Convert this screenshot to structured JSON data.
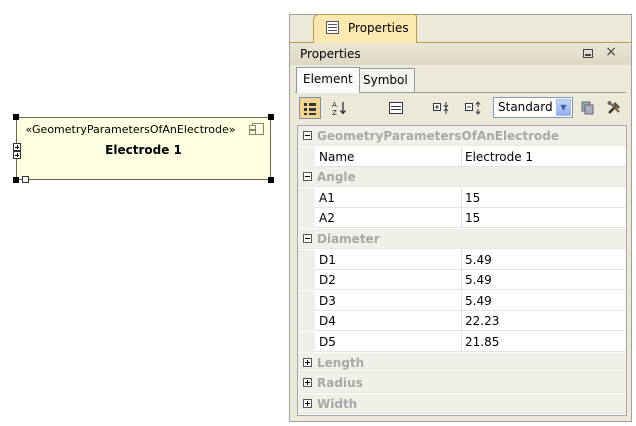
{
  "diagram": {
    "stereotype": "«GeometryParametersOfAnElectrode»",
    "name": "Electrode 1",
    "icon": "component-icon"
  },
  "panel": {
    "top_tab_label": "Properties",
    "title": "Properties",
    "close_symbol": "×",
    "tabs": [
      "Element",
      "Symbol"
    ],
    "active_tab": "Element",
    "toolbar": {
      "view_mode": "Standard",
      "dropdown_arrow": "▼"
    }
  },
  "properties": {
    "sections": [
      {
        "name": "GeometryParametersOfAnElectrode",
        "expanded": true,
        "rows": [
          {
            "name": "Name",
            "value": "Electrode 1"
          }
        ]
      },
      {
        "name": "Angle",
        "expanded": true,
        "rows": [
          {
            "name": "A1",
            "value": "15"
          },
          {
            "name": "A2",
            "value": "15"
          }
        ]
      },
      {
        "name": "Diameter",
        "expanded": true,
        "rows": [
          {
            "name": "D1",
            "value": "5.49"
          },
          {
            "name": "D2",
            "value": "5.49"
          },
          {
            "name": "D3",
            "value": "5.49"
          },
          {
            "name": "D4",
            "value": "22.23"
          },
          {
            "name": "D5",
            "value": "21.85"
          }
        ]
      },
      {
        "name": "Length",
        "expanded": false,
        "rows": []
      },
      {
        "name": "Radius",
        "expanded": false,
        "rows": []
      },
      {
        "name": "Width",
        "expanded": false,
        "rows": []
      }
    ]
  }
}
